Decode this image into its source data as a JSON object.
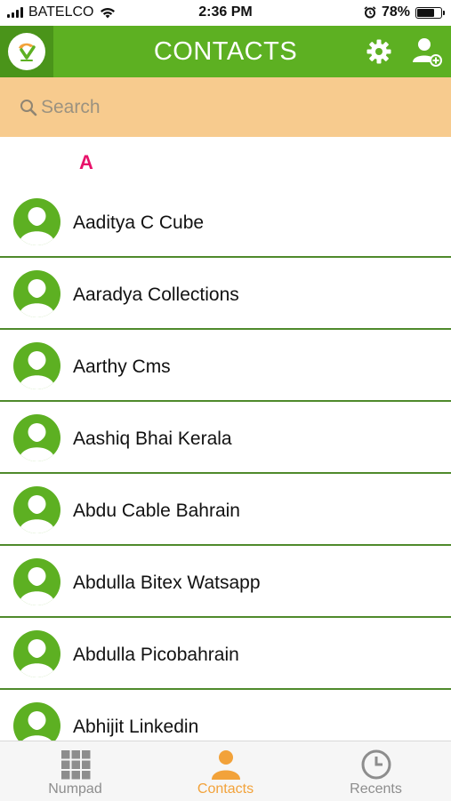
{
  "status_bar": {
    "carrier": "BATELCO",
    "time": "2:36 PM",
    "battery": "78%",
    "battery_level": 0.78
  },
  "header": {
    "title": "CONTACTS",
    "icons": [
      "app-logo-icon",
      "gear-icon",
      "add-contact-icon"
    ]
  },
  "search": {
    "placeholder": "Search"
  },
  "section": {
    "letter": "A"
  },
  "contacts": [
    {
      "name": "Aaditya C Cube"
    },
    {
      "name": "Aaradya Collections"
    },
    {
      "name": "Aarthy Cms"
    },
    {
      "name": "Aashiq Bhai Kerala"
    },
    {
      "name": "Abdu Cable Bahrain"
    },
    {
      "name": "Abdulla Bitex Watsapp"
    },
    {
      "name": "Abdulla Picobahrain"
    },
    {
      "name": "Abhijit Linkedin"
    }
  ],
  "tabs": [
    {
      "label": "Numpad",
      "icon": "grid-icon",
      "active": false
    },
    {
      "label": "Contacts",
      "icon": "person-icon",
      "active": true
    },
    {
      "label": "Recents",
      "icon": "clock-icon",
      "active": false
    }
  ],
  "colors": {
    "brand_green": "#5db022",
    "search_bg": "#f7cb8e",
    "section_letter": "#e8126a",
    "active_tab": "#f2a23a",
    "inactive_tab": "#8d8d8d"
  }
}
